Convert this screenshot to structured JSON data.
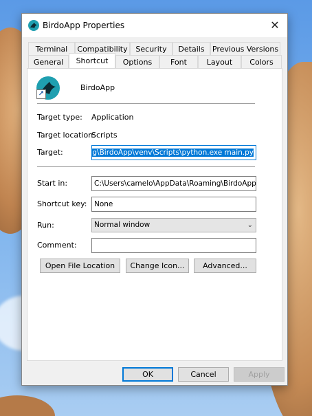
{
  "window": {
    "title": "BirdoApp Properties",
    "close_glyph": "✕"
  },
  "tabs_row1": [
    "Terminal",
    "Compatibility",
    "Security",
    "Details",
    "Previous Versions"
  ],
  "tabs_row2": [
    "General",
    "Shortcut",
    "Options",
    "Font",
    "Layout",
    "Colors"
  ],
  "active_tab": "Shortcut",
  "app": {
    "name": "BirdoApp",
    "icon": "bird-app-icon"
  },
  "info": {
    "target_type_label": "Target type:",
    "target_type_value": "Application",
    "target_location_label": "Target location:",
    "target_location_value": "Scripts"
  },
  "fields": {
    "target_label": "Target:",
    "target_value": "ming\\BirdoApp\\venv\\Scripts\\python.exe main.py",
    "start_in_label": "Start in:",
    "start_in_value": "C:\\Users\\camelo\\AppData\\Roaming\\BirdoApp",
    "shortcut_key_label": "Shortcut key:",
    "shortcut_key_value": "None",
    "run_label": "Run:",
    "run_value": "Normal window",
    "comment_label": "Comment:",
    "comment_value": ""
  },
  "actions": {
    "open_file_location": "Open File Location",
    "change_icon": "Change Icon...",
    "advanced": "Advanced..."
  },
  "footer": {
    "ok": "OK",
    "cancel": "Cancel",
    "apply": "Apply"
  },
  "colors": {
    "accent": "#0078d7",
    "icon_teal": "#1f9fb0",
    "icon_dark": "#0c2a33"
  }
}
